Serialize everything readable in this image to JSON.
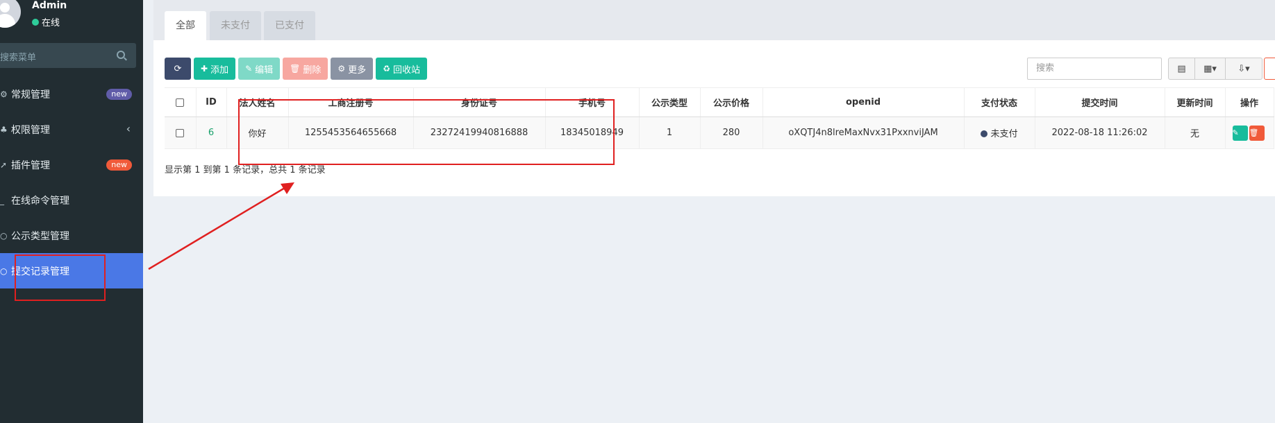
{
  "user": {
    "name": "Admin",
    "status": "在线"
  },
  "sidebar": {
    "search_placeholder": "搜索菜单",
    "items": [
      {
        "label": "常规管理",
        "icon": "cogs-icon",
        "badge": "new"
      },
      {
        "label": "权限管理",
        "icon": "group-icon"
      },
      {
        "label": "插件管理",
        "icon": "rocket-icon",
        "badge": "new"
      },
      {
        "label": "在线命令管理",
        "icon": "terminal-icon"
      },
      {
        "label": "公示类型管理",
        "icon": "circle-icon"
      },
      {
        "label": "提交记录管理",
        "icon": "circle-icon",
        "active": true
      }
    ]
  },
  "tabs": [
    "全部",
    "未支付",
    "已支付"
  ],
  "toolbar": {
    "add": "添加",
    "edit": "编辑",
    "delete": "删除",
    "more": "更多",
    "recycle": "回收站"
  },
  "search": {
    "placeholder": "搜索"
  },
  "table": {
    "headers": [
      "ID",
      "法人姓名",
      "工商注册号",
      "身份证号",
      "手机号",
      "公示类型",
      "公示价格",
      "openid",
      "支付状态",
      "提交时间",
      "更新时间",
      "操作"
    ],
    "rows": [
      {
        "id": "6",
        "name": "你好",
        "reg_no": "1255453564655668",
        "id_card": "23272419940816888",
        "phone": "18345018949",
        "type": "1",
        "price": "280",
        "openid": "oXQTJ4n8lreMaxNvx31PxxnviJAM",
        "pay_status": "未支付",
        "submit_time": "2022-08-18 11:26:02",
        "update_time": "无"
      }
    ]
  },
  "footer": "显示第 1 到第 1 条记录，总共 1 条记录",
  "colors": {
    "sidebar_bg": "#222d32",
    "active_menu": "#4a78e6",
    "success": "#18bc9c",
    "danger": "#f05a3a",
    "annotation": "#e02020"
  }
}
